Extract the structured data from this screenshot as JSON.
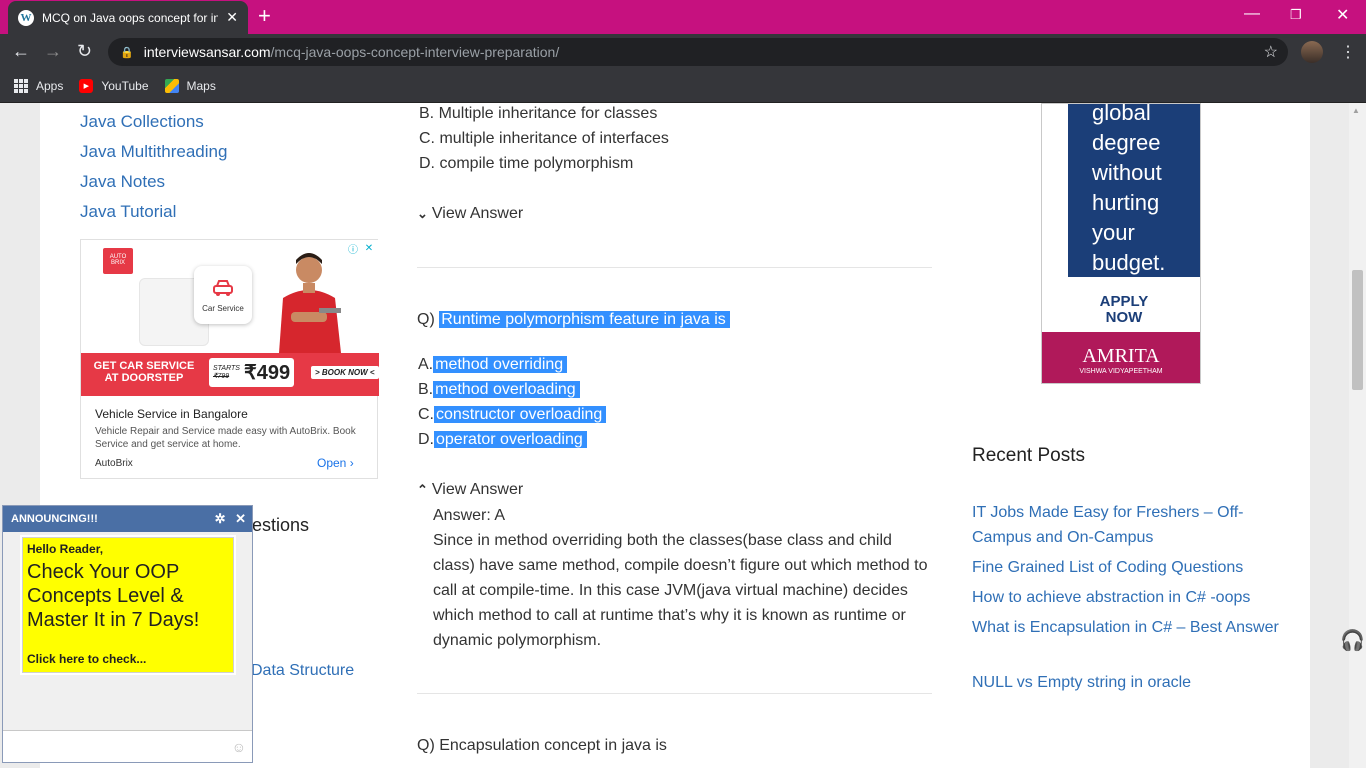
{
  "browser": {
    "tab_title": "MCQ on Java oops concept for in",
    "tab_close": "✕",
    "new_tab": "+",
    "url_host": "interviewsansar.com",
    "url_path": "/mcq-java-oops-concept-interview-preparation/",
    "bookmarks": [
      {
        "label": "Apps",
        "icon": "apps-grid-icon"
      },
      {
        "label": "YouTube",
        "icon": "youtube-icon"
      },
      {
        "label": "Maps",
        "icon": "maps-icon"
      }
    ]
  },
  "sidebar": {
    "links": [
      "Java Collections",
      "Java Multithreading",
      "Java Notes",
      "Java Tutorial"
    ],
    "partial_heading": "estions",
    "partial_link": "Data Structure"
  },
  "ad": {
    "cta": "GET CAR SERVICE AT DOORSTEP",
    "starts": "STARTS",
    "old_price": "₹799",
    "price": "₹499",
    "book_now": "> BOOK NOW <",
    "car_service": "Car Service",
    "title": "Vehicle Service in Bangalore",
    "desc": "Vehicle Repair and Service made easy with AutoBrix. Book Service and get service at home.",
    "brand": "AutoBrix",
    "open": "Open",
    "logo_text": "AUTO BRIX"
  },
  "questions": {
    "prev_options": [
      "B. Multiple inheritance for classes",
      "C. multiple inheritance of interfaces",
      "D. compile time polymorphism"
    ],
    "view_answer": "View Answer",
    "q_prefix": "Q)",
    "q_text": "Runtime polymorphism feature in java is",
    "options": [
      {
        "letter": "A.",
        "text": "method overriding"
      },
      {
        "letter": "B.",
        "text": "method overloading"
      },
      {
        "letter": "C.",
        "text": "constructor overloading"
      },
      {
        "letter": "D.",
        "text": "operator overloading"
      }
    ],
    "answer": "Answer: A",
    "explanation": "Since in method overriding both the classes(base class and child class) have same method, compile doesn’t figure out which method to call at compile-time. In this case JVM(java virtual machine) decides which method to call at runtime that’s why it is known as runtime or dynamic polymorphism.",
    "next_q": "Q) Encapsulation concept in java is"
  },
  "right_ad": {
    "lines": [
      "global",
      "degree",
      "without",
      "hurting",
      "your",
      "budget."
    ],
    "apply": "APPLY NOW",
    "name": "AMRITA",
    "sub": "VISHWA VIDYAPEETHAM"
  },
  "recent": {
    "title": "Recent Posts",
    "posts": [
      "IT Jobs Made Easy for Freshers – Off-Campus and On-Campus",
      "Fine Grained List of Coding Questions",
      "How to achieve abstraction in C# -oops",
      "What is Encapsulation in C# – Best Answer",
      "NULL vs Empty string in oracle"
    ]
  },
  "announce": {
    "header": "ANNOUNCING!!!",
    "hello": "Hello Reader,",
    "big": "Check Your OOP Concepts Level & Master It in 7 Days!",
    "click": "Click here to check..."
  }
}
